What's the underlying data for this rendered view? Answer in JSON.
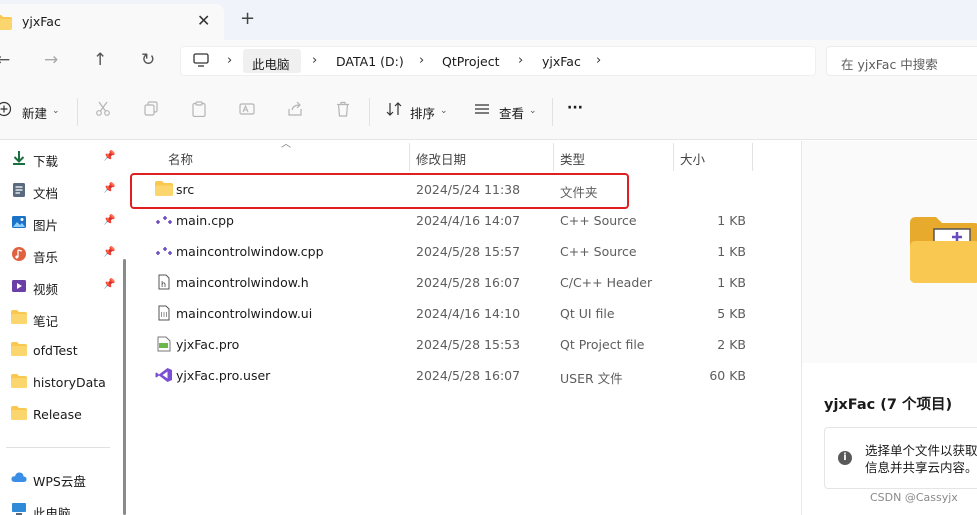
{
  "tab": {
    "title": "yjxFac",
    "close": "✕",
    "new_tab": "+"
  },
  "nav": {
    "back": "←",
    "forward": "→",
    "up": "↑",
    "refresh": "↻"
  },
  "breadcrumb": [
    "此电脑",
    "DATA1 (D:)",
    "QtProject",
    "yjxFac"
  ],
  "breadcrumb_sep": "›",
  "search": {
    "placeholder": "在 yjxFac 中搜索"
  },
  "commandbar": {
    "new_label": "新建",
    "sort_label": "排序",
    "view_label": "查看",
    "more_label": "···"
  },
  "sidebar": {
    "pinned": [
      {
        "label": "下载",
        "icon": "download-icon"
      },
      {
        "label": "文档",
        "icon": "documents-icon"
      },
      {
        "label": "图片",
        "icon": "pictures-icon"
      },
      {
        "label": "音乐",
        "icon": "music-icon"
      },
      {
        "label": "视频",
        "icon": "videos-icon"
      }
    ],
    "folders": [
      "笔记",
      "ofdTest",
      "historyData",
      "Release"
    ],
    "bottom": [
      "WPS云盘",
      "此电脑"
    ]
  },
  "columns": {
    "name": "名称",
    "date": "修改日期",
    "type": "类型",
    "size": "大小"
  },
  "files": [
    {
      "name": "src",
      "date": "2024/5/24 11:38",
      "type": "文件夹",
      "size": "",
      "icon": "folder-icon"
    },
    {
      "name": "main.cpp",
      "date": "2024/4/16 14:07",
      "type": "C++ Source",
      "size": "1 KB",
      "icon": "cpp-source-icon"
    },
    {
      "name": "maincontrolwindow.cpp",
      "date": "2024/5/28 15:57",
      "type": "C++ Source",
      "size": "1 KB",
      "icon": "cpp-source-icon"
    },
    {
      "name": "maincontrolwindow.h",
      "date": "2024/5/28 16:07",
      "type": "C/C++ Header",
      "size": "1 KB",
      "icon": "header-file-icon"
    },
    {
      "name": "maincontrolwindow.ui",
      "date": "2024/4/16 14:10",
      "type": "Qt UI file",
      "size": "5 KB",
      "icon": "ui-file-icon"
    },
    {
      "name": "yjxFac.pro",
      "date": "2024/5/28 15:53",
      "type": "Qt Project file",
      "size": "2 KB",
      "icon": "pro-file-icon"
    },
    {
      "name": "yjxFac.pro.user",
      "date": "2024/5/28 16:07",
      "type": "USER 文件",
      "size": "60 KB",
      "icon": "visual-studio-icon"
    }
  ],
  "details": {
    "title": "yjxFac (7 个项目)",
    "info": "选择单个文件以获取信息并共享云内容。",
    "info_icon": "i"
  },
  "watermark": "CSDN @Cassyjx",
  "colors": {
    "highlight": "#e02020",
    "folder": "#f8c851",
    "accent": "#0067c0"
  }
}
